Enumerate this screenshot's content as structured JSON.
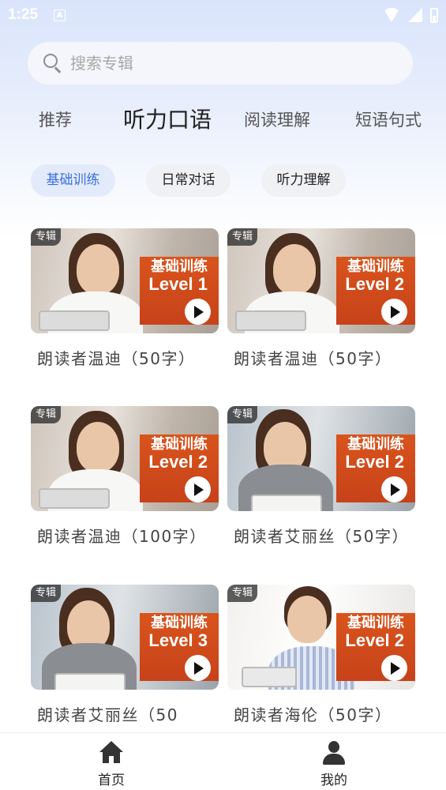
{
  "status_bar": {
    "time": "1:25",
    "notification_icon": "A"
  },
  "search": {
    "placeholder": "搜索专辑",
    "value": ""
  },
  "tabs": [
    {
      "label": "推荐",
      "active": false
    },
    {
      "label": "听力口语",
      "active": true
    },
    {
      "label": "阅读理解",
      "active": false
    },
    {
      "label": "短语句式",
      "active": false
    }
  ],
  "chips": [
    {
      "label": "基础训练",
      "active": true
    },
    {
      "label": "日常对话",
      "active": false
    },
    {
      "label": "听力理解",
      "active": false
    }
  ],
  "cards": [
    {
      "badge": "专辑",
      "overlay_line1": "基础训练",
      "overlay_line2": "Level 1",
      "title": "朗读者温迪（50字）"
    },
    {
      "badge": "专辑",
      "overlay_line1": "基础训练",
      "overlay_line2": "Level 2",
      "title": "朗读者温迪（50字）"
    },
    {
      "badge": "专辑",
      "overlay_line1": "基础训练",
      "overlay_line2": "Level 2",
      "title": "朗读者温迪（100字）"
    },
    {
      "badge": "专辑",
      "overlay_line1": "基础训练",
      "overlay_line2": "Level 2",
      "title": "朗读者艾丽丝（50字）"
    },
    {
      "badge": "专辑",
      "overlay_line1": "基础训练",
      "overlay_line2": "Level 3",
      "title": "朗读者艾丽丝（50"
    },
    {
      "badge": "专辑",
      "overlay_line1": "基础训练",
      "overlay_line2": "Level 2",
      "title": "朗读者海伦（50字）"
    }
  ],
  "bottom_nav": [
    {
      "label": "首页",
      "icon": "home-icon"
    },
    {
      "label": "我的",
      "icon": "user-icon"
    }
  ],
  "colors": {
    "accent": "#3b6fd9",
    "chip_active_bg": "#e3ebfb",
    "overlay_orange": "#d24b1b"
  }
}
